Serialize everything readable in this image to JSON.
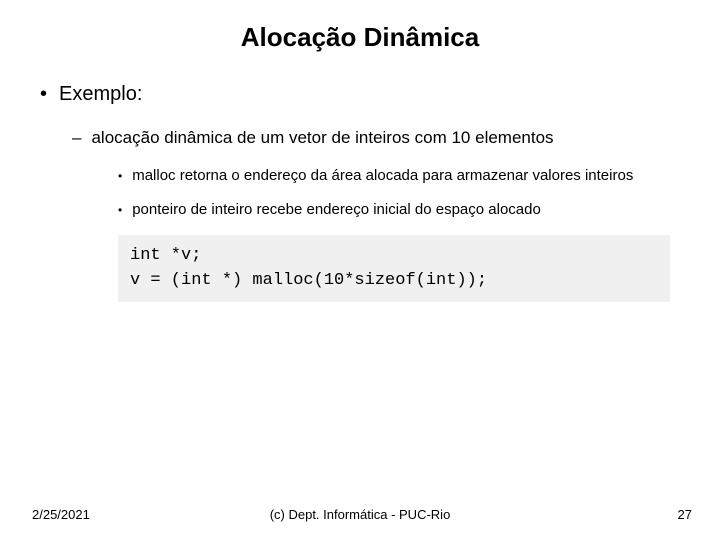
{
  "title": "Alocação Dinâmica",
  "lvl1": "Exemplo:",
  "lvl2": "alocação dinâmica de um vetor de inteiros com 10 elementos",
  "lvl3a": "malloc retorna o endereço da área alocada para armazenar valores inteiros",
  "lvl3b": "ponteiro de inteiro recebe endereço inicial do espaço alocado",
  "code": "int *v;\nv = (int *) malloc(10*sizeof(int));",
  "footer": {
    "date": "2/25/2021",
    "copyright": "(c) Dept. Informática - PUC-Rio",
    "page": "27"
  }
}
